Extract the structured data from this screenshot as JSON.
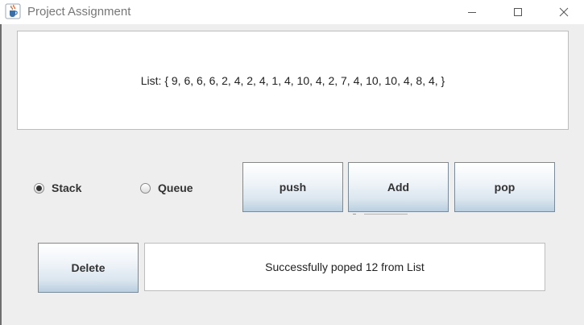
{
  "window": {
    "title": "Project Assignment",
    "icon": "java-cup-icon"
  },
  "list_panel": {
    "text": "List: { 9, 6, 6, 6, 2, 4, 2, 4, 1, 4, 10, 4, 2, 7, 4, 10, 10, 4, 8, 4, }"
  },
  "mode": {
    "options": [
      {
        "label": "Stack",
        "selected": true
      },
      {
        "label": "Queue",
        "selected": false
      }
    ]
  },
  "buttons": {
    "push": "push",
    "add": "Add",
    "pop": "pop",
    "delete": "Delete"
  },
  "status": {
    "text": "Successfully poped 12 from List"
  },
  "colors": {
    "window_bg": "#eeeeee",
    "panel_bg": "#ffffff",
    "button_gradient_bottom": "#b9cfe0"
  }
}
